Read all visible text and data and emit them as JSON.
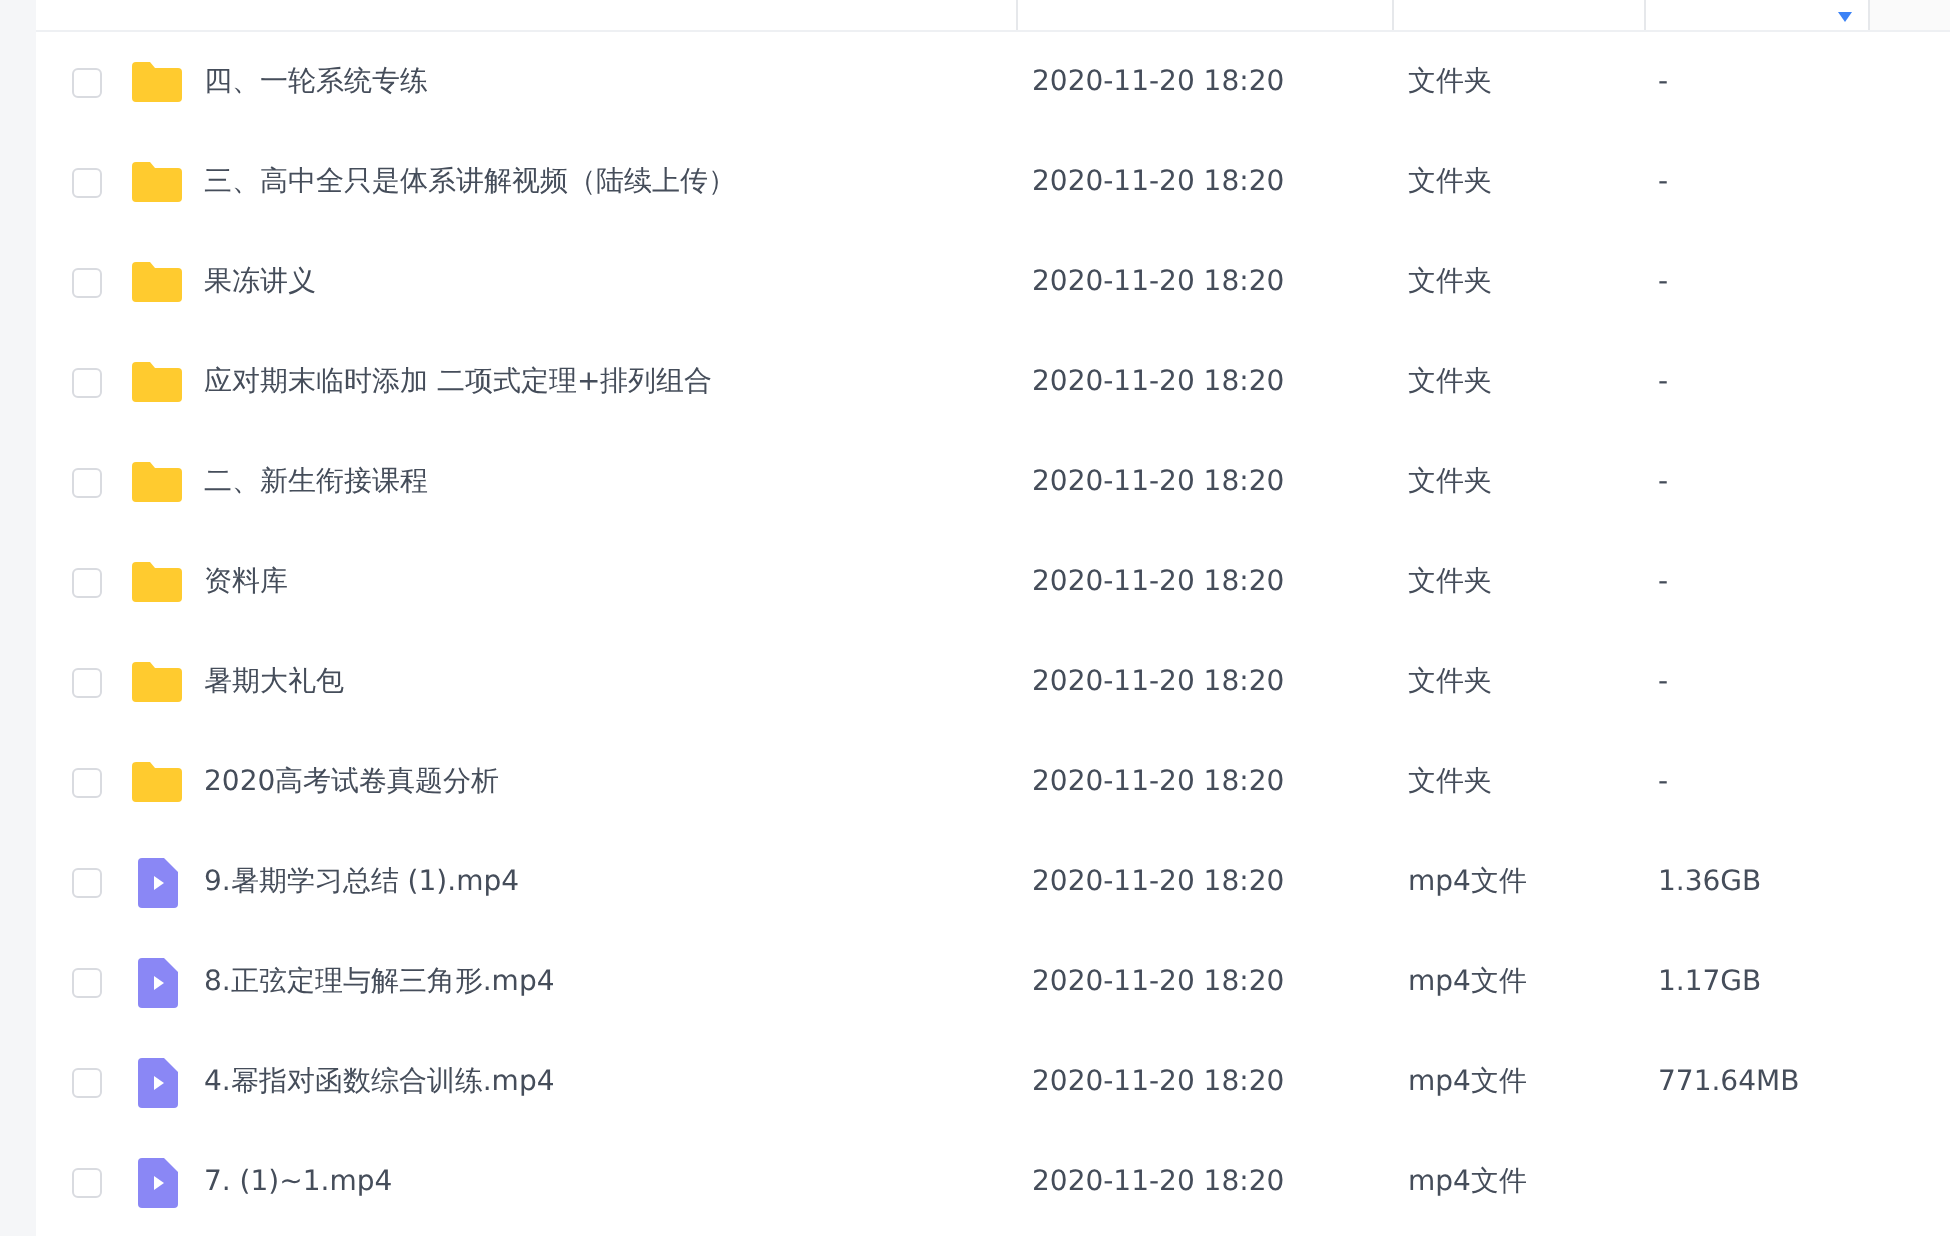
{
  "table": {
    "header": {
      "sort_descending": true
    },
    "rows": [
      {
        "kind": "folder",
        "name": "四、一轮系统专练",
        "modified": "2020-11-20 18:20",
        "type": "文件夹",
        "size": "-",
        "checked": false
      },
      {
        "kind": "folder",
        "name": "三、高中全只是体系讲解视频（陆续上传）",
        "modified": "2020-11-20 18:20",
        "type": "文件夹",
        "size": "-",
        "checked": false
      },
      {
        "kind": "folder",
        "name": "果冻讲义",
        "modified": "2020-11-20 18:20",
        "type": "文件夹",
        "size": "-",
        "checked": false
      },
      {
        "kind": "folder",
        "name": "应对期末临时添加 二项式定理+排列组合",
        "modified": "2020-11-20 18:20",
        "type": "文件夹",
        "size": "-",
        "checked": false
      },
      {
        "kind": "folder",
        "name": "二、新生衔接课程",
        "modified": "2020-11-20 18:20",
        "type": "文件夹",
        "size": "-",
        "checked": false
      },
      {
        "kind": "folder",
        "name": "资料库",
        "modified": "2020-11-20 18:20",
        "type": "文件夹",
        "size": "-",
        "checked": false
      },
      {
        "kind": "folder",
        "name": "暑期大礼包",
        "modified": "2020-11-20 18:20",
        "type": "文件夹",
        "size": "-",
        "checked": false
      },
      {
        "kind": "folder",
        "name": "2020高考试卷真题分析",
        "modified": "2020-11-20 18:20",
        "type": "文件夹",
        "size": "-",
        "checked": false
      },
      {
        "kind": "video",
        "name": "9.暑期学习总结 (1).mp4",
        "modified": "2020-11-20 18:20",
        "type": "mp4文件",
        "size": "1.36GB",
        "checked": false
      },
      {
        "kind": "video",
        "name": "8.正弦定理与解三角形.mp4",
        "modified": "2020-11-20 18:20",
        "type": "mp4文件",
        "size": "1.17GB",
        "checked": false
      },
      {
        "kind": "video",
        "name": "4.幂指对函数综合训练.mp4",
        "modified": "2020-11-20 18:20",
        "type": "mp4文件",
        "size": "771.64MB",
        "checked": false
      },
      {
        "kind": "video",
        "name": "7. (1)~1.mp4",
        "modified": "2020-11-20 18:20",
        "type": "mp4文件",
        "checked": false
      }
    ]
  }
}
